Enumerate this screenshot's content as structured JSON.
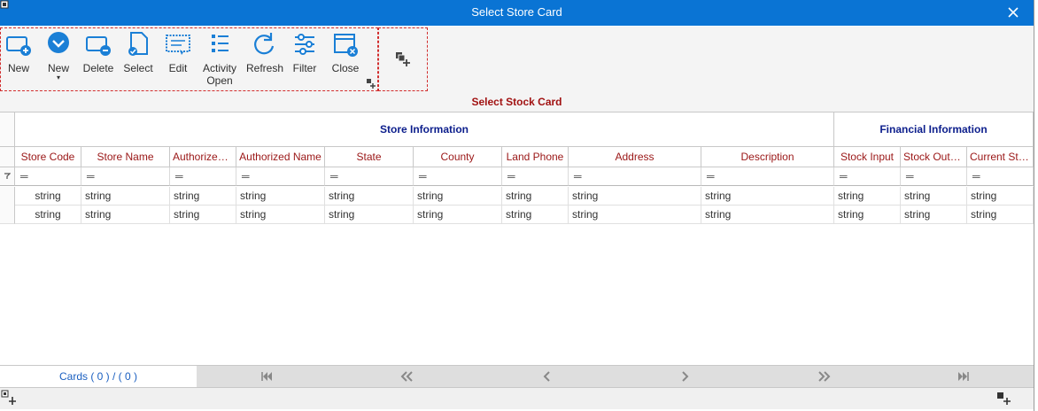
{
  "window": {
    "title": "Select Store Card"
  },
  "toolbar": {
    "buttons": [
      {
        "label": "New",
        "icon": "new-card-icon"
      },
      {
        "label": "New",
        "icon": "dropdown-circle-icon"
      },
      {
        "label": "Delete",
        "icon": "delete-card-icon"
      },
      {
        "label": "Select",
        "icon": "select-doc-icon"
      },
      {
        "label": "Edit",
        "icon": "edit-screen-icon"
      },
      {
        "label": "Activity Open",
        "icon": "list-icon"
      },
      {
        "label": "Refresh",
        "icon": "refresh-icon"
      },
      {
        "label": "Filter",
        "icon": "filter-sliders-icon"
      },
      {
        "label": "Close",
        "icon": "close-window-icon"
      }
    ]
  },
  "grid": {
    "caption": "Select Stock Card",
    "bands": [
      "Store Information",
      "Financial Information"
    ],
    "columns": [
      "Store Code",
      "Store Name",
      "Authorized ...",
      "Authorized Name",
      "State",
      "County",
      "Land Phone",
      "Address",
      "Description",
      "Stock Input",
      "Stock Output",
      "Current Stock"
    ],
    "filter_symbol": "═",
    "rows": [
      [
        "string",
        "string",
        "string",
        "string",
        "string",
        "string",
        "string",
        "string",
        "string",
        "string",
        "string",
        "string"
      ],
      [
        "string",
        "string",
        "string",
        "string",
        "string",
        "string",
        "string",
        "string",
        "string",
        "string",
        "string",
        "string"
      ]
    ]
  },
  "footer": {
    "cards_label": "Cards ( 0 ) / ( 0 )"
  },
  "colors": {
    "titlebar": "#0a74d4",
    "accent_red": "#a11212",
    "band_blue": "#0c1e8c",
    "icon_blue": "#1a7fd6"
  }
}
